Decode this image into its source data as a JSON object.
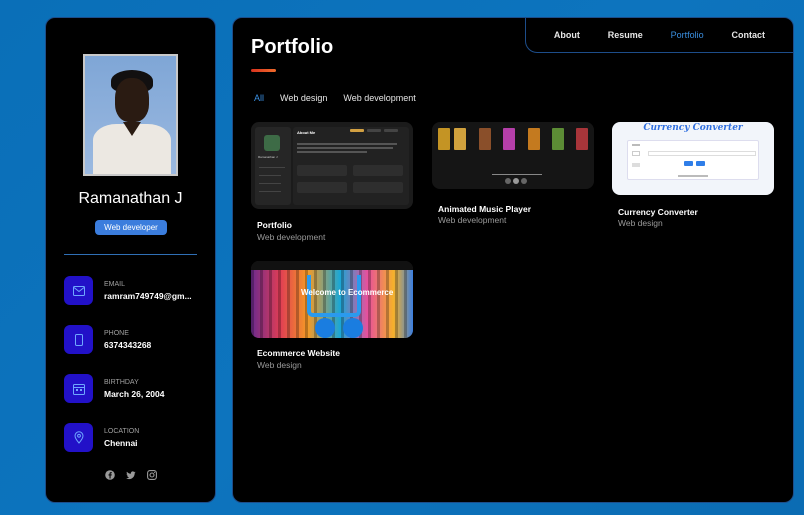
{
  "profile": {
    "name": "Ramanathan J",
    "role": "Web developer",
    "contacts": [
      {
        "label": "EMAIL",
        "value": "ramram749749@gm..."
      },
      {
        "label": "PHONE",
        "value": "6374343268"
      },
      {
        "label": "BIRTHDAY",
        "value": "March 26, 2004"
      },
      {
        "label": "LOCATION",
        "value": "Chennai"
      }
    ],
    "socials": [
      "facebook-icon",
      "twitter-icon",
      "instagram-icon"
    ]
  },
  "nav": {
    "items": [
      "About",
      "Resume",
      "Portfolio",
      "Contact"
    ],
    "active": "Portfolio"
  },
  "page": {
    "title": "Portfolio",
    "filters": [
      "All",
      "Web design",
      "Web development"
    ],
    "active_filter": "All"
  },
  "projects": [
    {
      "title": "Portfolio",
      "category": "Web development"
    },
    {
      "title": "Animated Music Player",
      "category": "Web development"
    },
    {
      "title": "Currency Converter",
      "category": "Web design"
    },
    {
      "title": "Ecommerce Website",
      "category": "Web design"
    }
  ],
  "thumb_text": {
    "currency_heading": "Currency Converter",
    "ecommerce_heading": "Welcome to Ecommerce",
    "portfolio_sidebar_name": "Ramanathan J",
    "portfolio_heading": "About Me"
  },
  "colors": {
    "accent": "#3a8fe0",
    "icon_box": "#2211c8",
    "badge": "#3b7ddd",
    "title_underline": "#d8321e"
  }
}
